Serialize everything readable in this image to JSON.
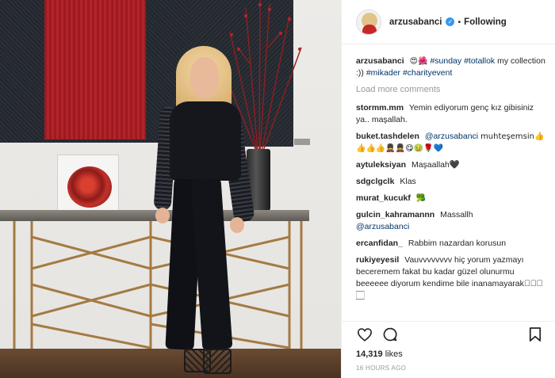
{
  "post": {
    "username": "arzusabanci",
    "follow_status": "Following",
    "separator": "•",
    "caption": {
      "user": "arzusabanci",
      "emoji": "😍🌺",
      "text_parts": [
        "#sunday",
        "#totallok",
        "my collection :))",
        "#mikader",
        "#charityevent"
      ]
    },
    "load_more": "Load more comments",
    "comments": [
      {
        "user": "stormm.mm",
        "text": "Yemin ediyorum genç kız gibisiniz ya.. maşallah."
      },
      {
        "user": "buket.tashdelen",
        "mention": "@arzusabanci",
        "text": "muhteşemsin👍👍👍👍💂💂😋🤢🌹💙"
      },
      {
        "user": "aytuleksiyan",
        "text": "Maşaallah🖤"
      },
      {
        "user": "sdgclgclk",
        "text": "Klas"
      },
      {
        "user": "murat_kucukf",
        "text": "🥦"
      },
      {
        "user": "gulcin_kahramannn",
        "text": "Massallh",
        "mention_after": "@arzusabanci"
      },
      {
        "user": "ercanfidan_",
        "text": "Rabbim nazardan korusun"
      },
      {
        "user": "rukiyeyesil",
        "text": "Vauvvvvvvvv hiç yorum yazmayı beceremem fakat bu kadar güzel olunurmu beeeeee diyorum kendime bile inanamayarak🏻🏻🏻🏻"
      }
    ],
    "likes_count": "14,319",
    "likes_word": "likes",
    "timestamp": "16 HOURS AGO"
  },
  "icons": {
    "verified": "verified-badge-icon",
    "like": "heart-icon",
    "comment": "comment-bubble-icon",
    "save": "bookmark-icon"
  }
}
